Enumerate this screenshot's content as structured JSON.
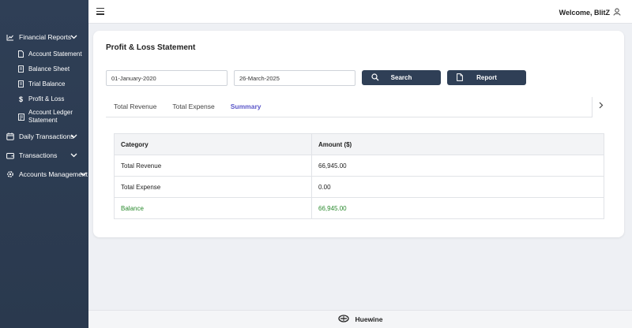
{
  "sidebar": {
    "groups": [
      {
        "label": "Financial Reports",
        "icon": "chart-line-icon"
      },
      {
        "label": "Daily Transactions",
        "icon": "calendar-icon"
      },
      {
        "label": "Transactions",
        "icon": "wallet-icon"
      },
      {
        "label": "Accounts Management",
        "icon": "gear-icon"
      }
    ],
    "items": [
      {
        "label": "Account Statement",
        "icon": "document-icon"
      },
      {
        "label": "Balance Sheet",
        "icon": "receipt-icon"
      },
      {
        "label": "Trial Balance",
        "icon": "receipt-icon"
      },
      {
        "label": "Profit & Loss",
        "icon": "dollar-icon"
      },
      {
        "label": "Account Ledger Statement",
        "icon": "ledger-icon"
      }
    ]
  },
  "header": {
    "welcome": "Welcome, BlitZ"
  },
  "main": {
    "title": "Profit & Loss Statement",
    "from_date": "01-January-2020",
    "to_date": "26-March-2025",
    "search_label": "Search",
    "report_label": "Report",
    "tabs": [
      {
        "label": "Total Revenue",
        "active": false
      },
      {
        "label": "Total Expense",
        "active": false
      },
      {
        "label": "Summary",
        "active": true
      }
    ],
    "table": {
      "headers": [
        "Category",
        "Amount ($)"
      ],
      "rows": [
        [
          "Total Revenue",
          "66,945.00"
        ],
        [
          "Total Expense",
          "0.00"
        ],
        [
          "Balance",
          "66,945.00"
        ]
      ]
    }
  },
  "footer": {
    "brand": "Huewine"
  },
  "colors": {
    "sidebar_bg": "#2f3f56",
    "accent_tab": "#5b57c9",
    "balance_green": "#2a8a2e"
  }
}
